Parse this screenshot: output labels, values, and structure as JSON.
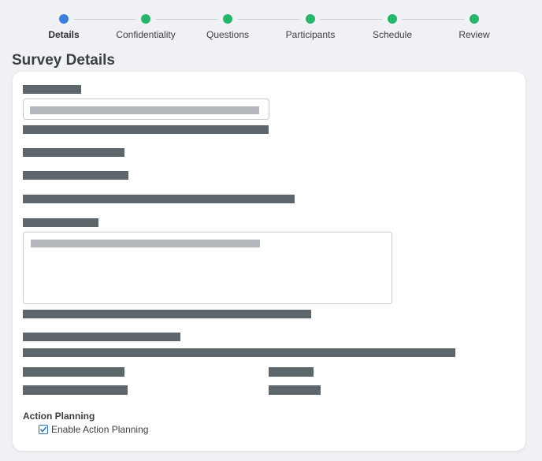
{
  "stepper": {
    "steps": [
      {
        "label": "Details",
        "status": "current"
      },
      {
        "label": "Confidentiality",
        "status": "complete"
      },
      {
        "label": "Questions",
        "status": "complete"
      },
      {
        "label": "Participants",
        "status": "complete"
      },
      {
        "label": "Schedule",
        "status": "complete"
      },
      {
        "label": "Review",
        "status": "complete"
      }
    ],
    "colors": {
      "current": "#3a7ddb",
      "complete": "#27b56b"
    }
  },
  "page": {
    "title": "Survey Details"
  },
  "action_planning": {
    "section_label": "Action Planning",
    "checkbox_label": "Enable Action Planning",
    "checked": true
  }
}
